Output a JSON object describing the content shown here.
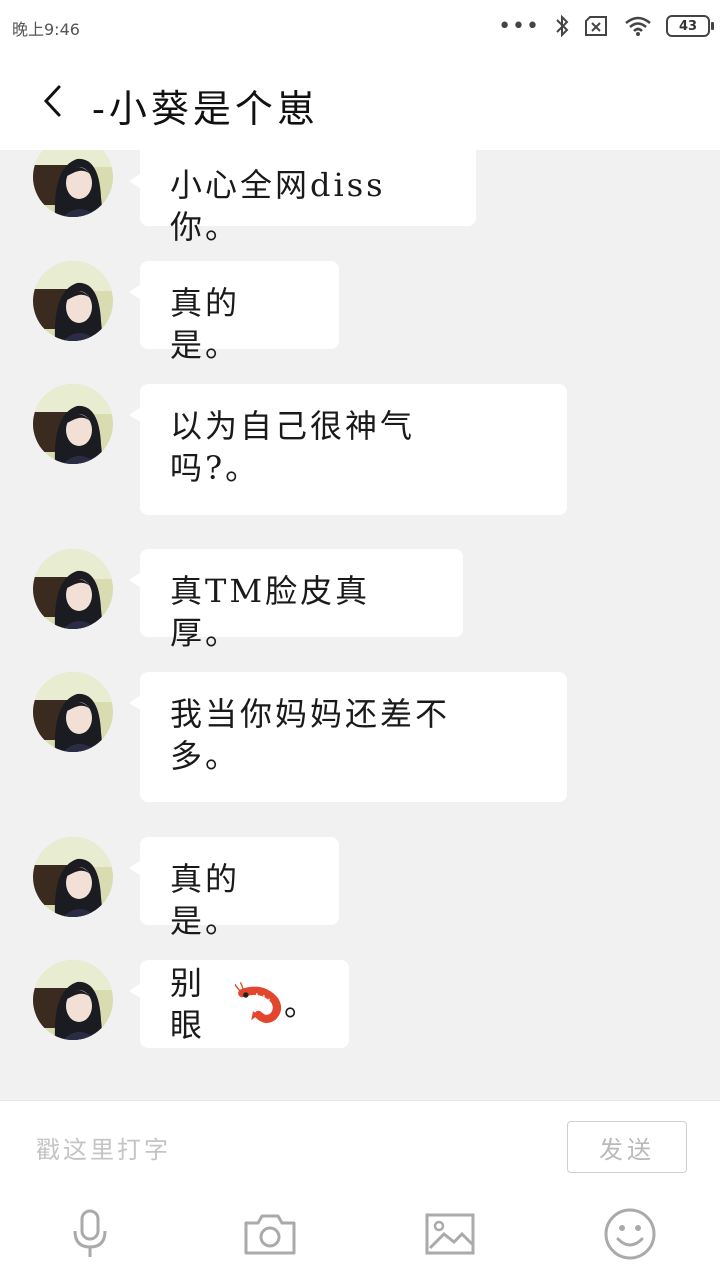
{
  "status_bar": {
    "time": "晚上9:46",
    "battery": "43"
  },
  "header": {
    "title": "-小葵是个崽"
  },
  "messages": [
    {
      "text": "小心全网diss你。"
    },
    {
      "text": "真的是。"
    },
    {
      "text": "以为自己很神气\n吗?。"
    },
    {
      "text": "真TM脸皮真厚。"
    },
    {
      "text": "我当你妈妈还差不\n多。"
    },
    {
      "text": "真的是。"
    },
    {
      "text": "别眼",
      "suffix": "。",
      "emoji": "shrimp-emoji"
    }
  ],
  "input": {
    "placeholder": "戳这里打字",
    "value": "",
    "send_label": "发送"
  },
  "toolbar": {
    "icons": [
      "microphone-icon",
      "camera-icon",
      "image-icon",
      "emoji-icon"
    ]
  },
  "colors": {
    "background": "#f1f1f1",
    "bubble": "#ffffff",
    "bar": "#ffffff"
  }
}
